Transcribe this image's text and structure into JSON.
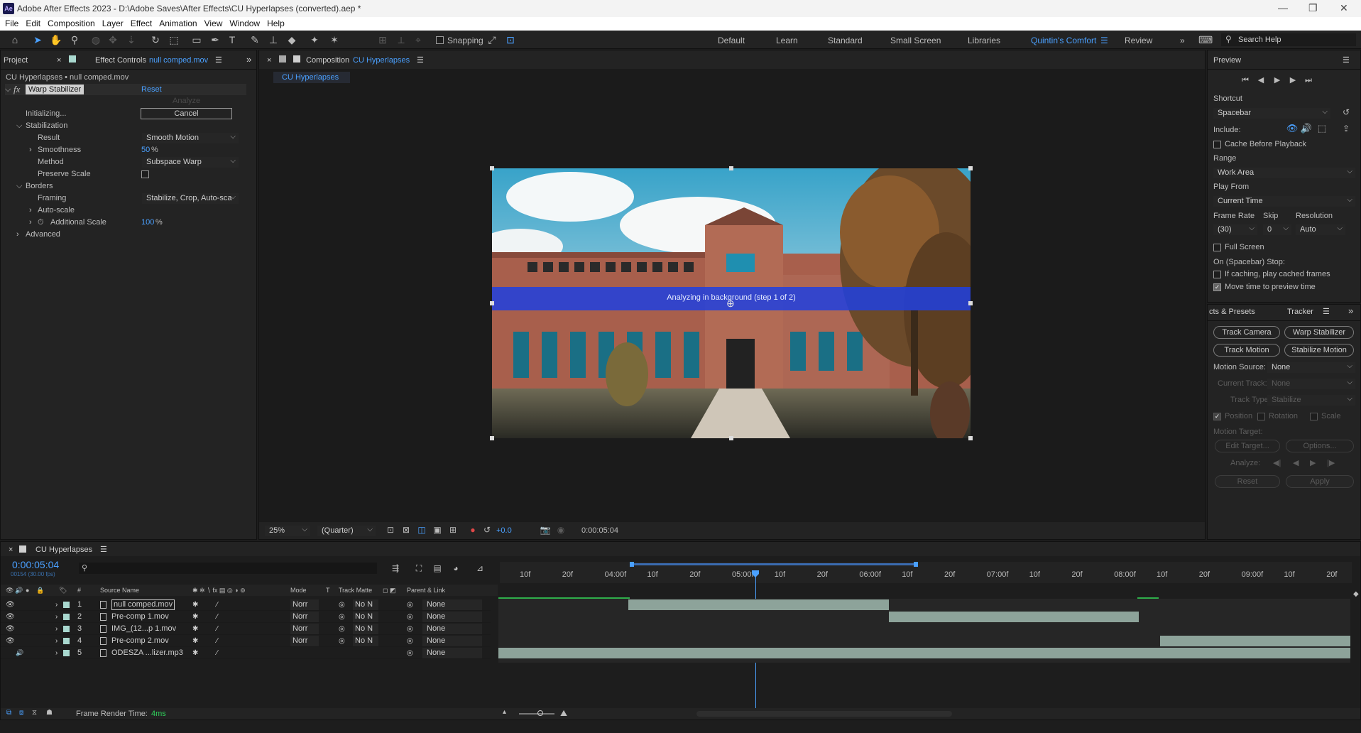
{
  "app": {
    "title": "Adobe After Effects 2023 - D:\\Adobe Saves\\After Effects\\CU Hyperlapses (converted).aep *",
    "logo": "Ae"
  },
  "menu": [
    "File",
    "Edit",
    "Composition",
    "Layer",
    "Effect",
    "Animation",
    "View",
    "Window",
    "Help"
  ],
  "toolbar": {
    "snapping": "Snapping",
    "workspaces": [
      "Default",
      "Learn",
      "Standard",
      "Small Screen",
      "Libraries",
      "Quintin's Comfort",
      "Review"
    ],
    "active_workspace": "Quintin's Comfort",
    "search": "Search Help"
  },
  "effect_panel": {
    "tab_project": "Project",
    "tab_effect": "Effect Controls",
    "tab_effect_file": "null comped.mov",
    "header": "CU Hyperlapses • null comped.mov",
    "effect_name": "Warp Stabilizer",
    "reset": "Reset",
    "analyze": "Analyze",
    "initializing": "Initializing...",
    "cancel": "Cancel",
    "stabilization": "Stabilization",
    "result_label": "Result",
    "result_value": "Smooth Motion",
    "smoothness_label": "Smoothness",
    "smoothness_value": "50",
    "pct": "%",
    "method_label": "Method",
    "method_value": "Subspace Warp",
    "preserve_scale": "Preserve Scale",
    "borders": "Borders",
    "framing_label": "Framing",
    "framing_value": "Stabilize, Crop, Auto-sca",
    "autoscale": "Auto-scale",
    "additional_scale": "Additional Scale",
    "additional_value": "100",
    "advanced": "Advanced"
  },
  "comp_panel": {
    "tab_label": "Composition",
    "tab_comp": "CU Hyperlapses",
    "sub_tab": "CU Hyperlapses",
    "analyzing": "Analyzing in background (step 1 of 2)",
    "zoom": "25%",
    "resolution": "(Quarter)",
    "exposure": "+0.0",
    "timecode": "0:00:05:04"
  },
  "preview": {
    "title": "Preview",
    "shortcut_label": "Shortcut",
    "shortcut": "Spacebar",
    "include": "Include:",
    "cache": "Cache Before Playback",
    "range_label": "Range",
    "range": "Work Area",
    "play_from_label": "Play From",
    "play_from": "Current Time",
    "frame_rate_label": "Frame Rate",
    "skip_label": "Skip",
    "resolution_label": "Resolution",
    "frame_rate": "(30)",
    "skip": "0",
    "resolution": "Auto",
    "full_screen": "Full Screen",
    "stop_label": "On (Spacebar) Stop:",
    "if_caching": "If caching, play cached frames",
    "move_time": "Move time to preview time"
  },
  "tracker": {
    "tab_effects": "cts & Presets",
    "tab_tracker": "Tracker",
    "track_camera": "Track Camera",
    "warp_stabilizer": "Warp Stabilizer",
    "track_motion": "Track Motion",
    "stabilize_motion": "Stabilize Motion",
    "motion_source": "Motion Source:",
    "motion_source_value": "None",
    "current_track": "Current Track:",
    "current_track_value": "None",
    "track_type": "Track Type:",
    "track_type_value": "Stabilize",
    "position": "Position",
    "rotation": "Rotation",
    "scale": "Scale",
    "motion_target": "Motion Target:",
    "edit_target": "Edit Target...",
    "options": "Options...",
    "analyze": "Analyze:",
    "reset": "Reset",
    "apply": "Apply"
  },
  "timeline": {
    "comp_name": "CU Hyperlapses",
    "timecode": "0:00:05:04",
    "timecode_sub": "00154 (30.00 fps)",
    "cols": {
      "source": "Source Name",
      "mode": "Mode",
      "t": "T",
      "matte": "Track Matte",
      "parent": "Parent & Link"
    },
    "layers": [
      {
        "num": "1",
        "name": "null comped.mov",
        "mode": "Norr",
        "matte": "No N",
        "parent": "None",
        "icon": "video"
      },
      {
        "num": "2",
        "name": "Pre-comp 1.mov",
        "mode": "Norr",
        "matte": "No N",
        "parent": "None",
        "icon": "video"
      },
      {
        "num": "3",
        "name": "IMG_(12...p 1.mov",
        "mode": "Norr",
        "matte": "No N",
        "parent": "None",
        "icon": "video"
      },
      {
        "num": "4",
        "name": "Pre-comp 2.mov",
        "mode": "Norr",
        "matte": "No N",
        "parent": "None",
        "icon": "video"
      },
      {
        "num": "5",
        "name": "ODESZA ...lizer.mp3",
        "mode": "",
        "matte": "",
        "parent": "None",
        "icon": "audio"
      }
    ],
    "ruler": [
      "10f",
      "20f",
      "04:00f",
      "10f",
      "20f",
      "05:00f",
      "10f",
      "20f",
      "06:00f",
      "10f",
      "20f",
      "07:00f",
      "10f",
      "20f",
      "08:00f",
      "10f",
      "20f",
      "09:00f",
      "10f",
      "20f"
    ],
    "render_label": "Frame Render Time:",
    "render_value": "4ms"
  },
  "colors": {
    "accent": "#2d8ceb",
    "analyzing_band": "#1f3fe0",
    "layer_bar": "#8da39a",
    "label_aqua": "#a9d8cf"
  }
}
